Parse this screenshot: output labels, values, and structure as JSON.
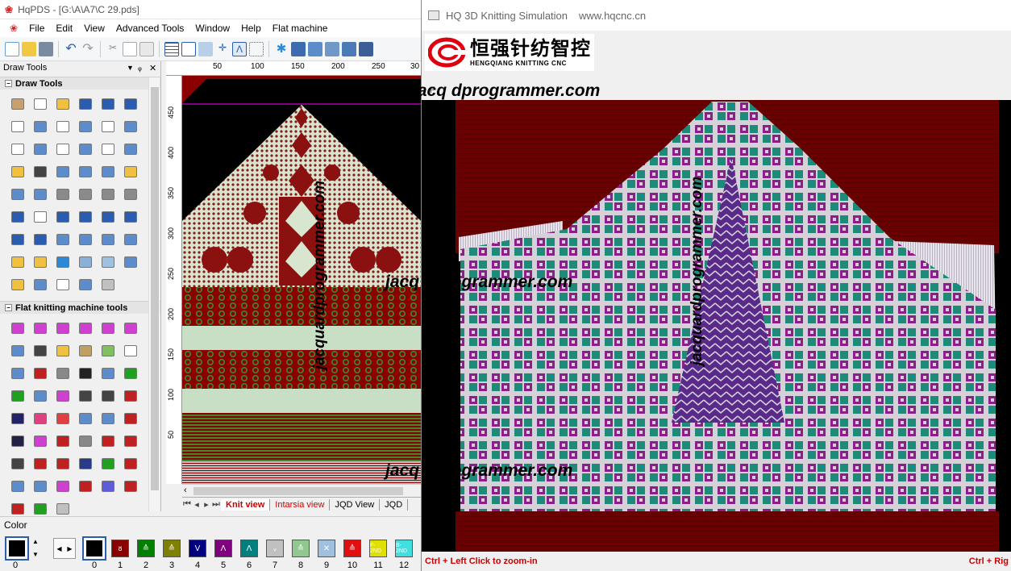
{
  "app": {
    "title": "HqPDS - [G:\\A\\A7\\C 29.pds]"
  },
  "menu": [
    "File",
    "Edit",
    "View",
    "Advanced Tools",
    "Window",
    "Help",
    "Flat machine"
  ],
  "draw_panel": {
    "title": "Draw Tools",
    "section1": "Draw Tools",
    "section2": "Flat knitting machine tools"
  },
  "ruler": {
    "top_ticks": [
      "50",
      "100",
      "150",
      "200",
      "250",
      "30"
    ],
    "left_ticks": [
      "450",
      "400",
      "350",
      "300",
      "250",
      "200",
      "150",
      "100",
      "50"
    ]
  },
  "tabs": [
    "Knit view",
    "Intarsia view",
    "JQD View",
    "JQD"
  ],
  "color": {
    "title": "Color",
    "current_index": "0",
    "selected_index": "0",
    "swatches": [
      {
        "num": "1",
        "color": "#8b0000",
        "glyph": "ᴕ"
      },
      {
        "num": "2",
        "color": "#008000",
        "glyph": "≙"
      },
      {
        "num": "3",
        "color": "#808000",
        "glyph": "≙"
      },
      {
        "num": "4",
        "color": "#000080",
        "glyph": "V"
      },
      {
        "num": "5",
        "color": "#800080",
        "glyph": "Λ"
      },
      {
        "num": "6",
        "color": "#008080",
        "glyph": "Λ"
      },
      {
        "num": "7",
        "color": "#c0c0c0",
        "glyph": "ᵥ"
      },
      {
        "num": "8",
        "color": "#90c890",
        "glyph": "≙"
      },
      {
        "num": "9",
        "color": "#a0c0e0",
        "glyph": "✕"
      },
      {
        "num": "10",
        "color": "#e01010",
        "glyph": "≙"
      },
      {
        "num": "11",
        "color": "#e0e000",
        "glyph": "F-2ND"
      },
      {
        "num": "12",
        "color": "#40e0e0",
        "glyph": "B-2ND"
      }
    ]
  },
  "sim": {
    "title": "HQ 3D Knitting Simulation",
    "url": "www.hqcnc.cn",
    "logo_cn": "恒强针纺智控",
    "logo_en": "HENGQIANG KNITTING CNC",
    "status_left": "Ctrl + Left Click to zoom-in",
    "status_right": "Ctrl + Rig"
  },
  "watermark": "jacquardprogrammer.com",
  "watermark_partial": "jacq    dprogrammer.com"
}
